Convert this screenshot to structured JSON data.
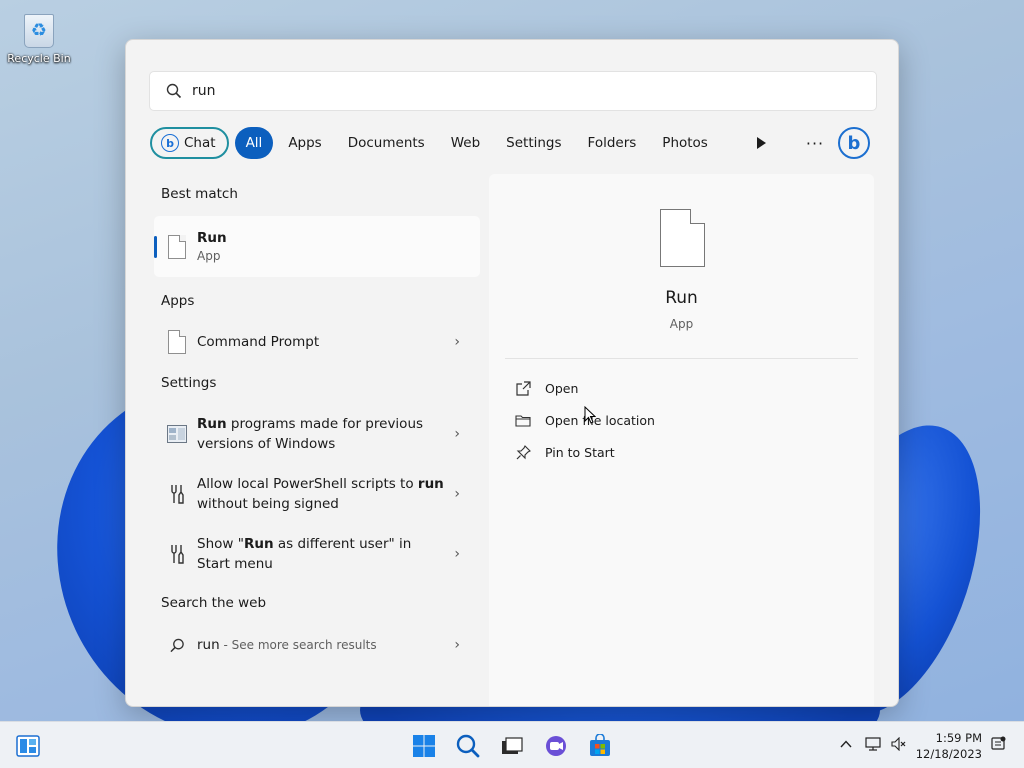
{
  "desktop": {
    "recycle_bin_label": "Recycle Bin"
  },
  "search": {
    "query": "run"
  },
  "filters": {
    "chat": "Chat",
    "all": "All",
    "apps": "Apps",
    "documents": "Documents",
    "web": "Web",
    "settings": "Settings",
    "folders": "Folders",
    "photos": "Photos"
  },
  "results": {
    "best_match_title": "Best match",
    "best": {
      "name": "Run",
      "type": "App"
    },
    "apps_title": "Apps",
    "apps": [
      {
        "name": "Command Prompt"
      }
    ],
    "settings_title": "Settings",
    "settings": [
      {
        "pre": "",
        "bold": "Run",
        "post": " programs made for previous versions of Windows"
      },
      {
        "pre": "Allow local PowerShell scripts to ",
        "bold": "run",
        "post": " without being signed"
      },
      {
        "pre": "Show \"",
        "bold": "Run",
        "post": " as different user\" in Start menu"
      }
    ],
    "web_title": "Search the web",
    "web": {
      "query": "run",
      "more": " - See more search results"
    }
  },
  "preview": {
    "title": "Run",
    "subtitle": "App",
    "actions": {
      "open": "Open",
      "open_location": "Open file location",
      "pin": "Pin to Start"
    }
  },
  "taskbar": {
    "time": "1:59 PM",
    "date": "12/18/2023"
  },
  "colors": {
    "accent": "#0c5fbe",
    "chat_border": "#1f8fa0"
  }
}
